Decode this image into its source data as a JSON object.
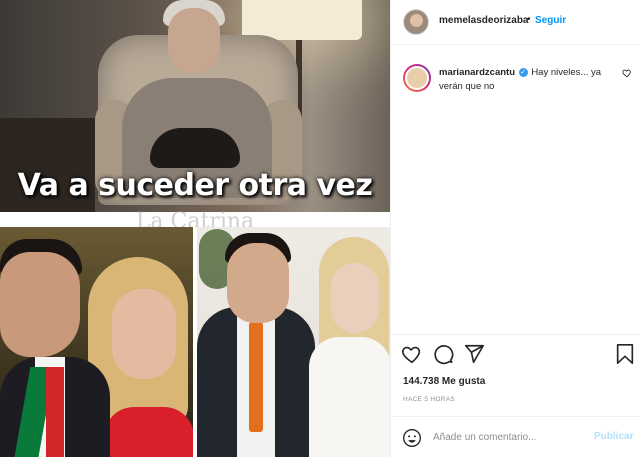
{
  "media": {
    "overlay_text": "Va a suceder otra vez",
    "watermark": "La Catrina"
  },
  "header": {
    "username": "memelasdeorizaba",
    "separator": "•",
    "follow_label": "Seguir",
    "more_label": "•••"
  },
  "comment": {
    "username": "marianardzcantu",
    "text": "Hay niveles... ya verán que no"
  },
  "actions": {
    "icons": [
      "heart-icon",
      "comment-icon",
      "share-icon",
      "bookmark-icon"
    ]
  },
  "likes": "144.738 Me gusta",
  "timestamp": "HACE 5 HORAS",
  "add_comment": {
    "placeholder": "Añade un comentario...",
    "publish_label": "Publicar"
  },
  "colors": {
    "link_blue": "#0095f6",
    "publish_disabled": "#b2dffc",
    "text": "#262626",
    "muted": "#8e8e8e",
    "verified": "#3897f0"
  }
}
